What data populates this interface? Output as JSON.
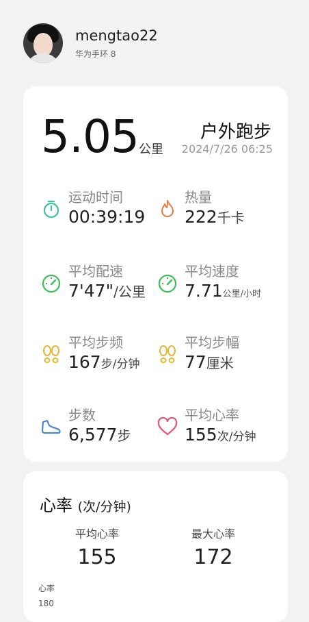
{
  "profile": {
    "username": "mengtao22",
    "device": "华为手环 8"
  },
  "summary": {
    "distance": "5.05",
    "distance_unit": "公里",
    "sport": "户外跑步",
    "datetime": "2024/7/26 06:25"
  },
  "metrics": [
    {
      "label": "运动时间",
      "value": "00:39:19",
      "unit": "",
      "icon": "stopwatch-icon",
      "color": "#3fbf9a"
    },
    {
      "label": "热量",
      "value": "222",
      "unit": "千卡",
      "icon": "flame-icon",
      "color": "#e07a45"
    },
    {
      "label": "平均配速",
      "value": "7'47\"",
      "unit": "/公里",
      "icon": "speedometer-icon",
      "color": "#3cbf56"
    },
    {
      "label": "平均速度",
      "value": "7.71",
      "unit": "公里/小时",
      "icon": "speedometer-icon",
      "color": "#3cbf56"
    },
    {
      "label": "平均步频",
      "value": "167",
      "unit": "步/分钟",
      "icon": "footprints-icon",
      "color": "#e8b531"
    },
    {
      "label": "平均步幅",
      "value": "77",
      "unit": "厘米",
      "icon": "footprints-icon",
      "color": "#e8b531"
    },
    {
      "label": "步数",
      "value": "6,577",
      "unit": "步",
      "icon": "shoe-icon",
      "color": "#4a84d6"
    },
    {
      "label": "平均心率",
      "value": "155",
      "unit": "次/分钟",
      "icon": "heart-icon",
      "color": "#e5567a"
    }
  ],
  "heart_rate": {
    "title": "心率",
    "unit": "(次/分钟)",
    "avg_label": "平均心率",
    "avg_value": "155",
    "max_label": "最大心率",
    "max_value": "172",
    "axis_label": "心率",
    "axis_top": "180"
  }
}
